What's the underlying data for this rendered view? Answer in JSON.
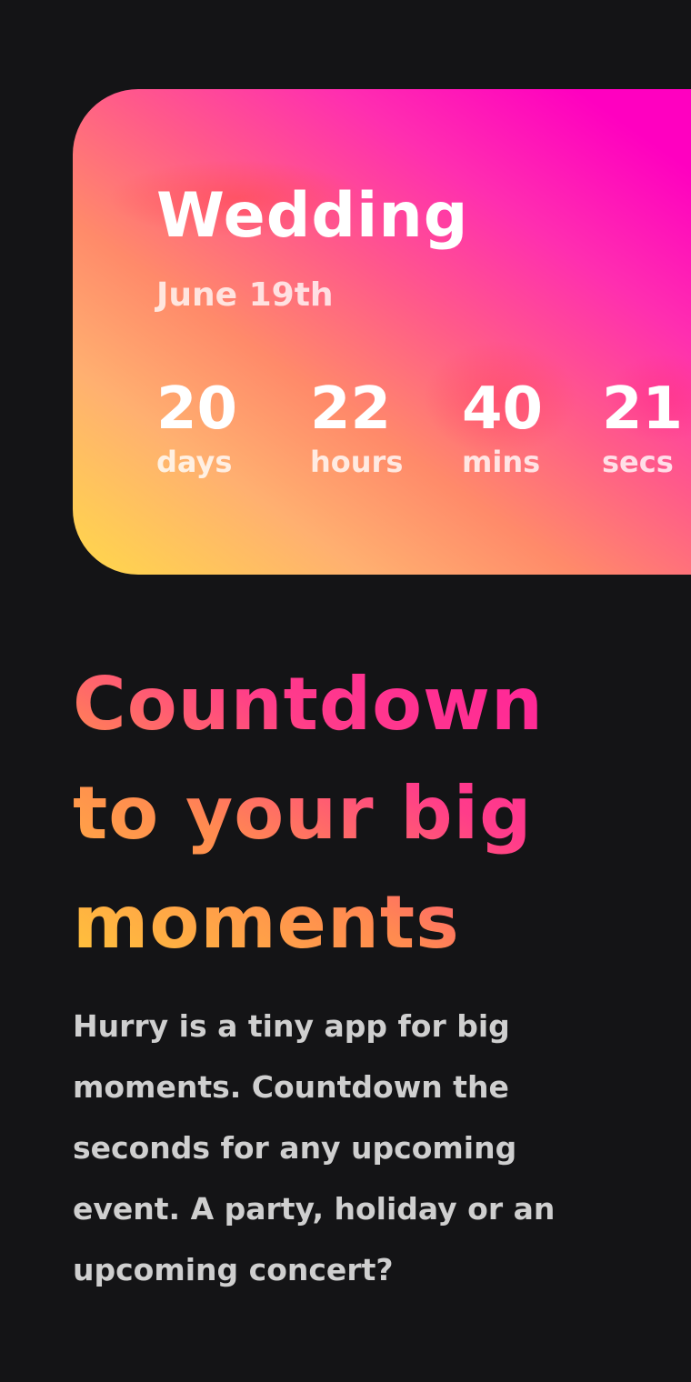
{
  "card": {
    "title": "Wedding",
    "date": "June 19th",
    "countdown": [
      {
        "value": "20",
        "label": "days"
      },
      {
        "value": "22",
        "label": "hours"
      },
      {
        "value": "40",
        "label": "mins"
      },
      {
        "value": "21",
        "label": "secs"
      }
    ]
  },
  "headline": "Countdown to your big moments",
  "description": "Hurry is a tiny app for big moments. Countdown the seconds for any upcoming event. A party, holiday or an upcoming concert?",
  "colors": {
    "background": "#141416",
    "gradient_start": "#ffd84a",
    "gradient_end": "#ff00c0"
  }
}
